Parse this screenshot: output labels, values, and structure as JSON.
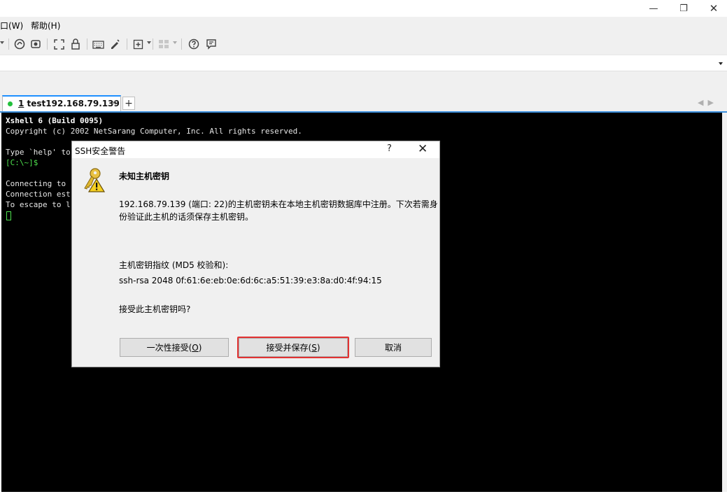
{
  "window": {
    "minimize_icon": "minimize-icon",
    "maximize_icon": "restore-icon",
    "close_icon": "close-icon",
    "minimize_glyph": "—",
    "restore_glyph": "❐",
    "close_glyph": "✕"
  },
  "menu": {
    "window_label": "口(W)",
    "help_label": "帮助(H)"
  },
  "toolbar": {
    "icons": [
      "dropdown-arrow-icon",
      "xftp-icon",
      "transfer-icon",
      "fullscreen-icon",
      "lock-icon",
      "keyboard-icon",
      "script-icon",
      "new-tab-icon",
      "layout-icon",
      "help-icon",
      "chat-icon"
    ]
  },
  "tabs": {
    "active_number": "1",
    "active_name": " test192.168.79.139",
    "close_glyph": "×",
    "add_glyph": "+",
    "nav_glyphs": "◀▶",
    "status_color": "#22c03c"
  },
  "terminal": {
    "line1": "Xshell 6 (Build 0095)",
    "line2": "Copyright (c) 2002 NetSarang Computer, Inc. All rights reserved.",
    "line3": "Type `help' to",
    "line4": "[C:\\~]$",
    "line5": "Connecting to",
    "line6": "Connection est",
    "line7": "To escape to l"
  },
  "dialog": {
    "title": "SSH安全警告",
    "help_glyph": "?",
    "close_glyph": "✕",
    "icon": "key-warning-icon",
    "heading": "未知主机密钥",
    "message_line1": "192.168.79.139 (端口: 22)的主机密钥未在本地主机密钥数据库中注册。下次若需身",
    "message_line2": "份验证此主机的话须保存主机密钥。",
    "fingerprint_label": "主机密钥指纹 (MD5 校验和):",
    "fingerprint": "ssh-rsa 2048 0f:61:6e:eb:0e:6d:6c:a5:51:39:e3:8a:d0:4f:94:15",
    "question": "接受此主机密钥吗?",
    "btn_once_text": "一次性接受(",
    "btn_once_key": "O",
    "btn_once_end": ")",
    "btn_save_text": "接受并保存(",
    "btn_save_key": "S",
    "btn_save_end": ")",
    "btn_cancel": "取消",
    "highlight_color": "#e23232"
  }
}
